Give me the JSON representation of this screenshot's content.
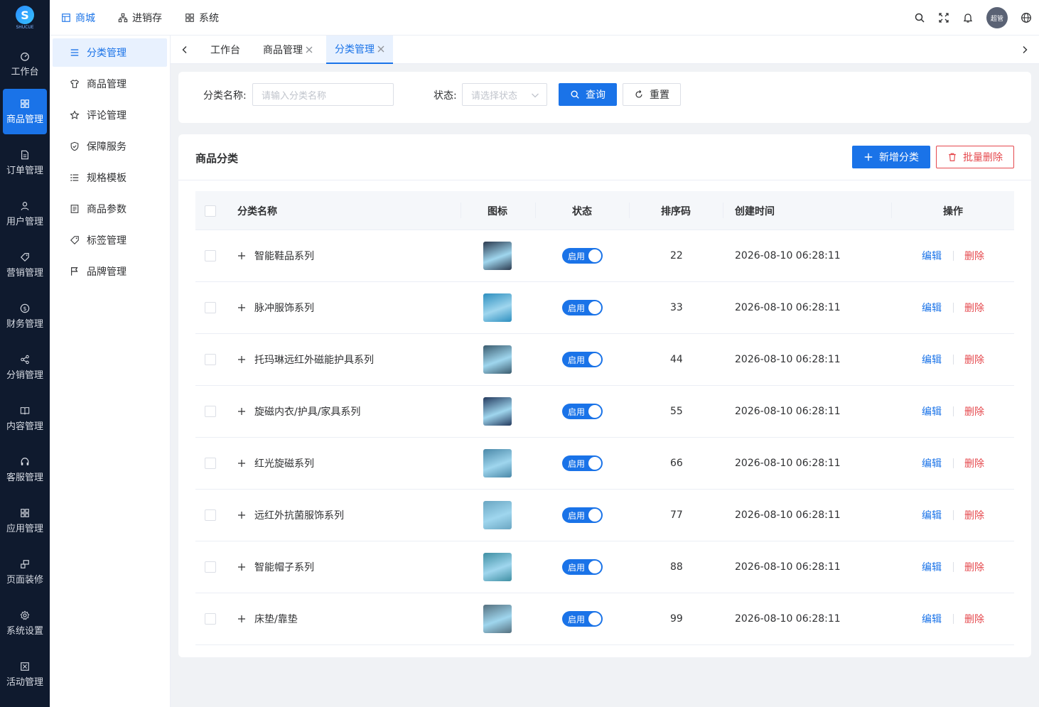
{
  "logo": {
    "mark": "S",
    "text": "SHUCUE"
  },
  "sidebar": {
    "items": [
      {
        "label": "工作台",
        "icon": "dashboard-icon"
      },
      {
        "label": "商品管理",
        "icon": "grid-icon",
        "active": true
      },
      {
        "label": "订单管理",
        "icon": "document-icon"
      },
      {
        "label": "用户管理",
        "icon": "user-icon"
      },
      {
        "label": "营销管理",
        "icon": "tag-icon"
      },
      {
        "label": "财务管理",
        "icon": "money-icon"
      },
      {
        "label": "分销管理",
        "icon": "share-icon"
      },
      {
        "label": "内容管理",
        "icon": "book-icon"
      },
      {
        "label": "客服管理",
        "icon": "headset-icon"
      },
      {
        "label": "应用管理",
        "icon": "apps-icon"
      },
      {
        "label": "页面装修",
        "icon": "layout-icon"
      },
      {
        "label": "系统设置",
        "icon": "gear-icon"
      },
      {
        "label": "活动管理",
        "icon": "activity-icon"
      }
    ]
  },
  "topnav": {
    "items": [
      {
        "label": "商城",
        "active": true
      },
      {
        "label": "进销存"
      },
      {
        "label": "系统"
      }
    ],
    "avatar": "超管"
  },
  "submenu": {
    "items": [
      {
        "label": "分类管理",
        "active": true
      },
      {
        "label": "商品管理"
      },
      {
        "label": "评论管理"
      },
      {
        "label": "保障服务"
      },
      {
        "label": "规格模板"
      },
      {
        "label": "商品参数"
      },
      {
        "label": "标签管理"
      },
      {
        "label": "品牌管理"
      }
    ]
  },
  "tabs": [
    {
      "label": "工作台"
    },
    {
      "label": "商品管理",
      "closable": true
    },
    {
      "label": "分类管理",
      "closable": true,
      "active": true
    }
  ],
  "search": {
    "name_label": "分类名称:",
    "name_placeholder": "请输入分类名称",
    "status_label": "状态:",
    "status_placeholder": "请选择状态",
    "query_label": "查询",
    "reset_label": "重置"
  },
  "table": {
    "title": "商品分类",
    "add_label": "新增分类",
    "batch_delete_label": "批量删除",
    "columns": [
      "分类名称",
      "图标",
      "状态",
      "排序码",
      "创建时间",
      "操作"
    ],
    "edit_label": "编辑",
    "delete_label": "删除",
    "rows": [
      {
        "name": "智能鞋品系列",
        "status": "启用",
        "sort": "22",
        "created": "2026-08-10 06:28:11",
        "thumb_color": "#2b3a4f"
      },
      {
        "name": "脉冲服饰系列",
        "status": "启用",
        "sort": "33",
        "created": "2026-08-10 06:28:11",
        "thumb_color": "#2d8fbf"
      },
      {
        "name": "托玛琳远红外磁能护具系列",
        "status": "启用",
        "sort": "44",
        "created": "2026-08-10 06:28:11",
        "thumb_color": "#3a5b6e"
      },
      {
        "name": "旋磁内衣/护具/家具系列",
        "status": "启用",
        "sort": "55",
        "created": "2026-08-10 06:28:11",
        "thumb_color": "#243a5e"
      },
      {
        "name": "红光旋磁系列",
        "status": "启用",
        "sort": "66",
        "created": "2026-08-10 06:28:11",
        "thumb_color": "#4a88a8"
      },
      {
        "name": "远红外抗菌服饰系列",
        "status": "启用",
        "sort": "77",
        "created": "2026-08-10 06:28:11",
        "thumb_color": "#6aa6c2"
      },
      {
        "name": "智能帽子系列",
        "status": "启用",
        "sort": "88",
        "created": "2026-08-10 06:28:11",
        "thumb_color": "#3f8fa3"
      },
      {
        "name": "床垫/靠垫",
        "status": "启用",
        "sort": "99",
        "created": "2026-08-10 06:28:11",
        "thumb_color": "#55707f"
      }
    ]
  }
}
